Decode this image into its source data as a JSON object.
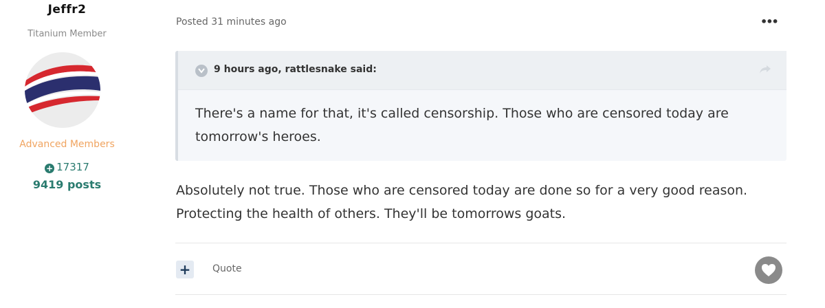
{
  "author": {
    "name": "Jeffr2",
    "title": "Titanium Member",
    "group": "Advanced Members",
    "reputation": "17317",
    "posts": "9419 posts"
  },
  "post": {
    "posted": "Posted 31 minutes ago",
    "quote": {
      "citation": "9 hours ago, rattlesnake said:",
      "text": "There's a name for that, it's called censorship. Those who are censored today are tomorrow's heroes."
    },
    "body": "Absolutely not true.  Those who are censored today are done so for a very good reason.  Protecting the health of others.  They'll be tomorrows goats.",
    "actions": {
      "plus_label": "+",
      "quote_label": "Quote"
    }
  },
  "icons": {
    "more": "ellipsis-icon",
    "quote_toggle": "chevron-down-icon",
    "share": "share-arrow-icon",
    "like": "heart-icon"
  },
  "colors": {
    "reputation": "#2a7b6f",
    "group": "#f0a460",
    "quote_bg": "#f5f7fa"
  }
}
